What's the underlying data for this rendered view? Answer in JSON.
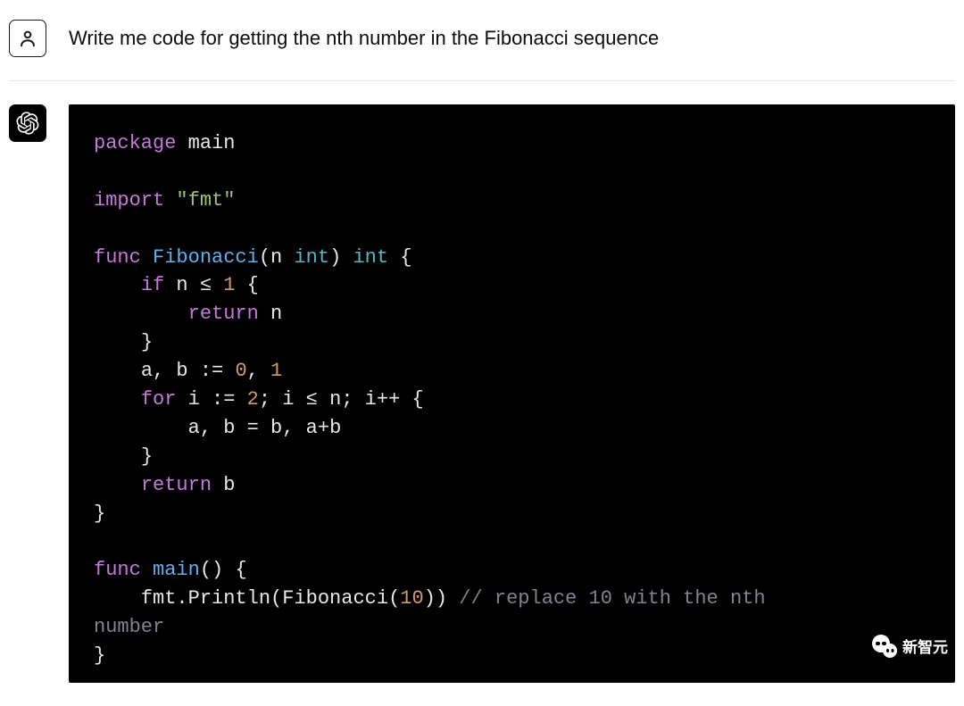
{
  "user": {
    "prompt": "Write me code for getting the nth number in the Fibonacci sequence"
  },
  "assistant": {
    "code": {
      "language": "go",
      "tokens": {
        "kw_package": "package",
        "id_main": "main",
        "kw_import": "import",
        "str_fmt": "\"fmt\"",
        "kw_func": "func",
        "fn_fib": "Fibonacci",
        "param_n": "n",
        "ty_int": "int",
        "kw_if": "if",
        "op_le": "≤",
        "num_1": "1",
        "kw_return": "return",
        "id_a": "a",
        "id_b": "b",
        "op_decl": ":=",
        "num_0": "0",
        "kw_for": "for",
        "id_i": "i",
        "num_2": "2",
        "op_inc": "++",
        "fn_main": "main",
        "call_fmt": "fmt",
        "call_println": "Println",
        "num_10": "10",
        "comment_tail": "// replace 10 with the nth",
        "wrap_number": "number"
      }
    }
  },
  "watermark": {
    "text": "新智元"
  }
}
